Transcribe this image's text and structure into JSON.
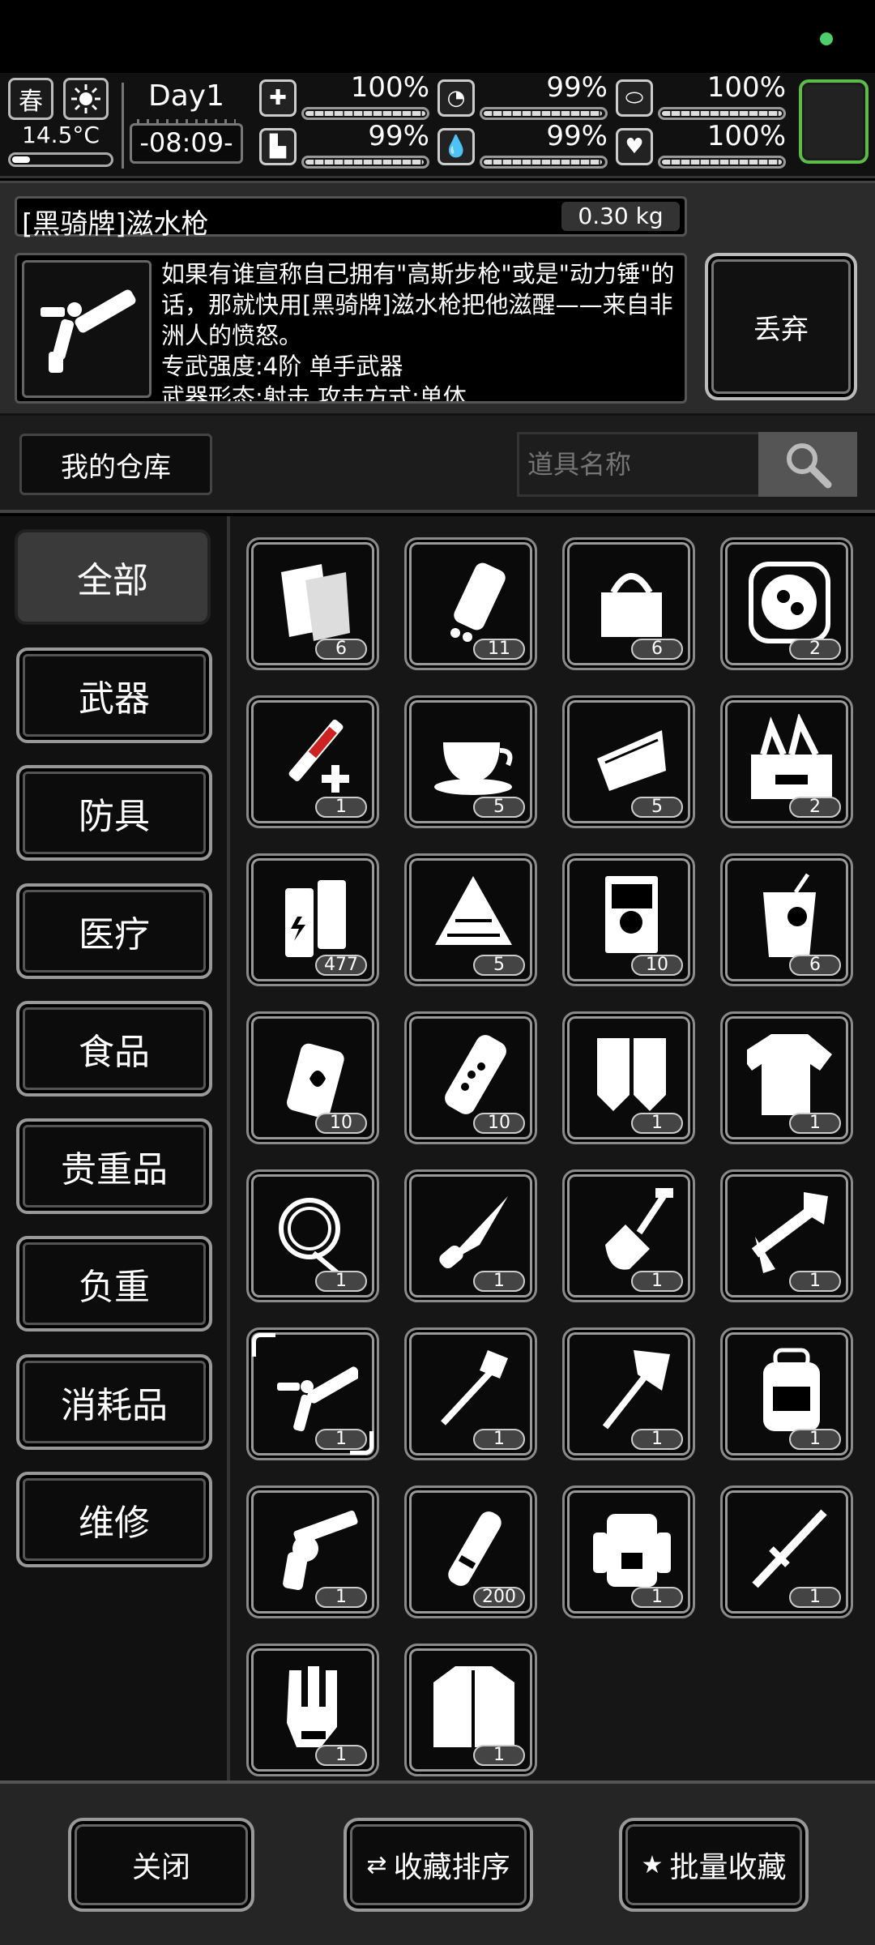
{
  "status": {
    "indicator_color": "#4ccf6a"
  },
  "hud": {
    "season": "春",
    "temperature": "14.5°C",
    "day": "Day1",
    "time": "-08:09-",
    "stats": [
      {
        "icon": "medkit-icon",
        "value": "100%",
        "level": 1.0
      },
      {
        "icon": "stomach-icon",
        "value": "99%",
        "level": 0.99
      },
      {
        "icon": "pill-icon",
        "value": "100%",
        "level": 1.0
      },
      {
        "icon": "foot-icon",
        "value": "99%",
        "level": 0.99
      },
      {
        "icon": "water-drop-icon",
        "value": "99%",
        "level": 0.99
      },
      {
        "icon": "heart-icon",
        "value": "100%",
        "level": 1.0
      }
    ],
    "slot_accent": "#5dbb4a"
  },
  "item": {
    "name": "[黑骑牌]滋水枪",
    "weight": "0.30 kg",
    "description": "如果有谁宣称自己拥有\"高斯步枪\"或是\"动力锤\"的话，那就快用[黑骑牌]滋水枪把他滋醒——来自非洲人的愤怒。",
    "specialty": "专武强度:4阶 单手武器",
    "extra": "武器形态:射击 攻击方式:单体",
    "discard": "丢弃"
  },
  "warehouse": {
    "title": "我的仓库",
    "search_placeholder": "道具名称"
  },
  "categories": [
    "全部",
    "武器",
    "防具",
    "医疗",
    "食品",
    "贵重品",
    "负重",
    "消耗品",
    "维修"
  ],
  "items": [
    {
      "icon": "bandage-roll-icon",
      "count": "6"
    },
    {
      "icon": "pill-bottle-icon",
      "count": "11"
    },
    {
      "icon": "tool-bag-icon",
      "count": "6"
    },
    {
      "icon": "food-tray-icon",
      "count": "2"
    },
    {
      "icon": "syringe-icon",
      "count": "1"
    },
    {
      "icon": "coffee-cup-icon",
      "count": "5"
    },
    {
      "icon": "cake-slice-icon",
      "count": "5"
    },
    {
      "icon": "toolbox-icon",
      "count": "2"
    },
    {
      "icon": "battery-icon",
      "count": "477"
    },
    {
      "icon": "rice-dumpling-icon",
      "count": "5"
    },
    {
      "icon": "book-icon",
      "count": "10"
    },
    {
      "icon": "drink-glass-icon",
      "count": "6"
    },
    {
      "icon": "incendiary-grenade-icon",
      "count": "10"
    },
    {
      "icon": "flashbang-icon",
      "count": "10"
    },
    {
      "icon": "gloves-icon",
      "count": "1"
    },
    {
      "icon": "tshirt-icon",
      "count": "1"
    },
    {
      "icon": "rope-icon",
      "count": "1"
    },
    {
      "icon": "folding-knife-icon",
      "count": "1"
    },
    {
      "icon": "shovel-icon",
      "count": "1"
    },
    {
      "icon": "hatchet-icon",
      "count": "1"
    },
    {
      "icon": "water-gun-icon",
      "count": "1",
      "selected": true
    },
    {
      "icon": "spade-icon",
      "count": "1"
    },
    {
      "icon": "axe-icon",
      "count": "1"
    },
    {
      "icon": "backpack-icon",
      "count": "1"
    },
    {
      "icon": "revolver-icon",
      "count": "1"
    },
    {
      "icon": "ammo-icon",
      "count": "200"
    },
    {
      "icon": "hiking-backpack-icon",
      "count": "1"
    },
    {
      "icon": "baton-icon",
      "count": "1"
    },
    {
      "icon": "glove-hand-icon",
      "count": "1"
    },
    {
      "icon": "jacket-icon",
      "count": "1"
    }
  ],
  "bottom": {
    "close": "关闭",
    "sort_favorites": "收藏排序",
    "batch_favorite": "批量收藏"
  }
}
